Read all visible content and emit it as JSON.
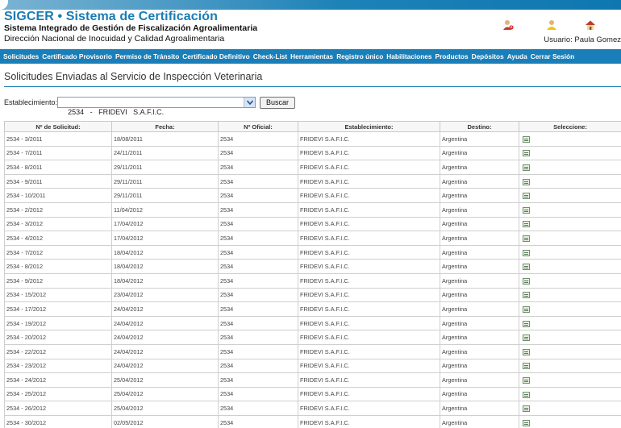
{
  "header": {
    "brand_title": "SIGCER • Sistema de Certificación",
    "brand_subtitle": "Sistema Integrado de Gestión de Fiscalización Agroalimentaria",
    "direction": "Dirección Nacional de Inocuidad y Calidad Agroalimentaria",
    "user_label": "Usuario: Paula Gomez",
    "icons": [
      "user-alert-icon",
      "user-icon",
      "home-icon"
    ]
  },
  "nav": [
    "Solicitudes",
    "Certificado Provisorio",
    "Permiso de Tránsito",
    "Certificado Definitivo",
    "Check-List",
    "Herramientas",
    "Registro único",
    "Habilitaciones",
    "Productos",
    "Depósitos",
    "Ayuda",
    "Cerrar Sesión"
  ],
  "page_title": "Solicitudes Enviadas al Servicio de Inspección Veterinaria",
  "filter": {
    "label": "Establecimiento:",
    "selected": "2534   -   FRIDEVI   S.A.F.I.C.",
    "button": "Buscar"
  },
  "table": {
    "columns": [
      "Nº de Solicitud:",
      "Fecha:",
      "Nº Oficial:",
      "Establecimiento:",
      "Destino:",
      "Seleccione:"
    ],
    "rows": [
      [
        "2534 - 3/2011",
        "18/08/2011",
        "2534",
        "FRIDEVI S.A.F.I.C.",
        "Argentina"
      ],
      [
        "2534 - 7/2011",
        "24/11/2011",
        "2534",
        "FRIDEVI S.A.F.I.C.",
        "Argentina"
      ],
      [
        "2534 - 8/2011",
        "29/11/2011",
        "2534",
        "FRIDEVI S.A.F.I.C.",
        "Argentina"
      ],
      [
        "2534 - 9/2011",
        "29/11/2011",
        "2534",
        "FRIDEVI S.A.F.I.C.",
        "Argentina"
      ],
      [
        "2534 - 10/2011",
        "29/11/2011",
        "2534",
        "FRIDEVI S.A.F.I.C.",
        "Argentina"
      ],
      [
        "2534 - 2/2012",
        "11/04/2012",
        "2534",
        "FRIDEVI S.A.F.I.C.",
        "Argentina"
      ],
      [
        "2534 - 3/2012",
        "17/04/2012",
        "2534",
        "FRIDEVI S.A.F.I.C.",
        "Argentina"
      ],
      [
        "2534 - 4/2012",
        "17/04/2012",
        "2534",
        "FRIDEVI S.A.F.I.C.",
        "Argentina"
      ],
      [
        "2534 - 7/2012",
        "18/04/2012",
        "2534",
        "FRIDEVI S.A.F.I.C.",
        "Argentina"
      ],
      [
        "2534 - 8/2012",
        "18/04/2012",
        "2534",
        "FRIDEVI S.A.F.I.C.",
        "Argentina"
      ],
      [
        "2534 - 9/2012",
        "18/04/2012",
        "2534",
        "FRIDEVI S.A.F.I.C.",
        "Argentina"
      ],
      [
        "2534 - 15/2012",
        "23/04/2012",
        "2534",
        "FRIDEVI S.A.F.I.C.",
        "Argentina"
      ],
      [
        "2534 - 17/2012",
        "24/04/2012",
        "2534",
        "FRIDEVI S.A.F.I.C.",
        "Argentina"
      ],
      [
        "2534 - 19/2012",
        "24/04/2012",
        "2534",
        "FRIDEVI S.A.F.I.C.",
        "Argentina"
      ],
      [
        "2534 - 20/2012",
        "24/04/2012",
        "2534",
        "FRIDEVI S.A.F.I.C.",
        "Argentina"
      ],
      [
        "2534 - 22/2012",
        "24/04/2012",
        "2534",
        "FRIDEVI S.A.F.I.C.",
        "Argentina"
      ],
      [
        "2534 - 23/2012",
        "24/04/2012",
        "2534",
        "FRIDEVI S.A.F.I.C.",
        "Argentina"
      ],
      [
        "2534 - 24/2012",
        "25/04/2012",
        "2534",
        "FRIDEVI S.A.F.I.C.",
        "Argentina"
      ],
      [
        "2534 - 25/2012",
        "25/04/2012",
        "2534",
        "FRIDEVI S.A.F.I.C.",
        "Argentina"
      ],
      [
        "2534 - 26/2012",
        "25/04/2012",
        "2534",
        "FRIDEVI S.A.F.I.C.",
        "Argentina"
      ],
      [
        "2534 - 30/2012",
        "02/05/2012",
        "2534",
        "FRIDEVI S.A.F.I.C.",
        "Argentina"
      ]
    ],
    "select_icon": "select-document-icon"
  }
}
